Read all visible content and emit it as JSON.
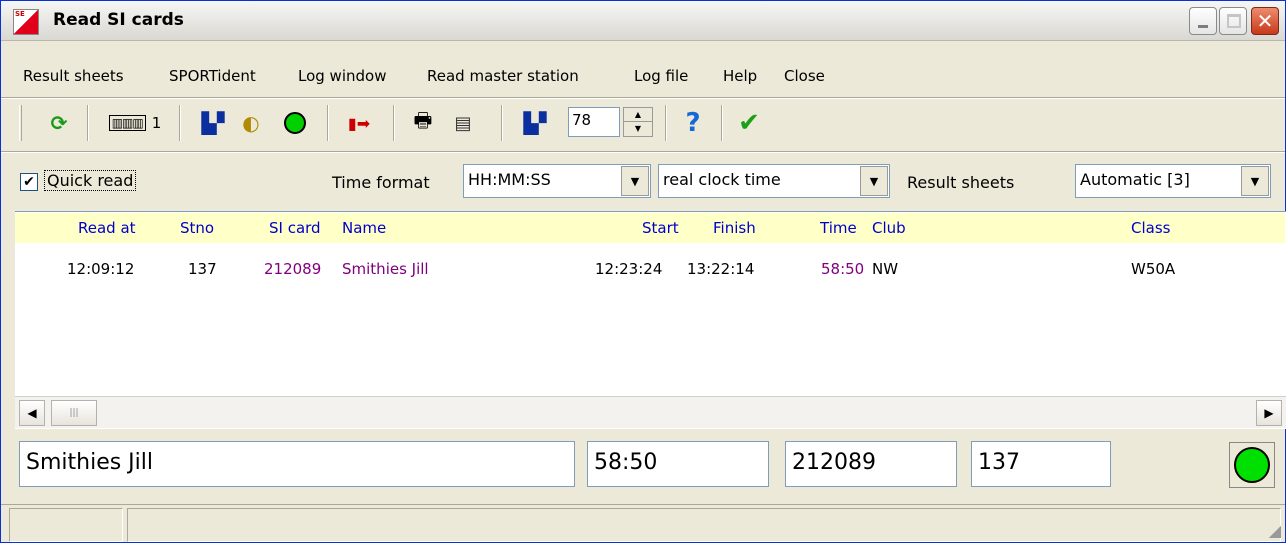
{
  "window": {
    "title": "Read SI cards"
  },
  "menu": [
    "Result sheets",
    "SPORTident",
    "Log window",
    "Read master station",
    "Log file",
    "Help",
    "Close"
  ],
  "toolbar": {
    "reader_label": "1",
    "spin_value": "78"
  },
  "options": {
    "quick_read_label": "Quick read",
    "quick_read_checked": true,
    "time_format_label": "Time format",
    "time_format_value": "HH:MM:SS",
    "clock_mode_value": "real clock time",
    "result_sheets_label": "Result sheets",
    "result_sheets_value": "Automatic [3]"
  },
  "table": {
    "headers": [
      "Read at",
      "Stno",
      "SI card",
      "Name",
      "Start",
      "Finish",
      "Time",
      "Club",
      "Class"
    ],
    "rows": [
      [
        "12:09:12",
        "137",
        "212089",
        "Smithies Jill",
        "12:23:24",
        "13:22:14",
        "58:50",
        "NW",
        "W50A"
      ]
    ]
  },
  "summary": {
    "name": "Smithies Jill",
    "time": "58:50",
    "si_card": "212089",
    "stno": "137"
  },
  "colors": {
    "header_bg": "#ffffc8",
    "header_text": "#0000cc",
    "accent_purple": "#800080",
    "status_light": "#00e000"
  }
}
